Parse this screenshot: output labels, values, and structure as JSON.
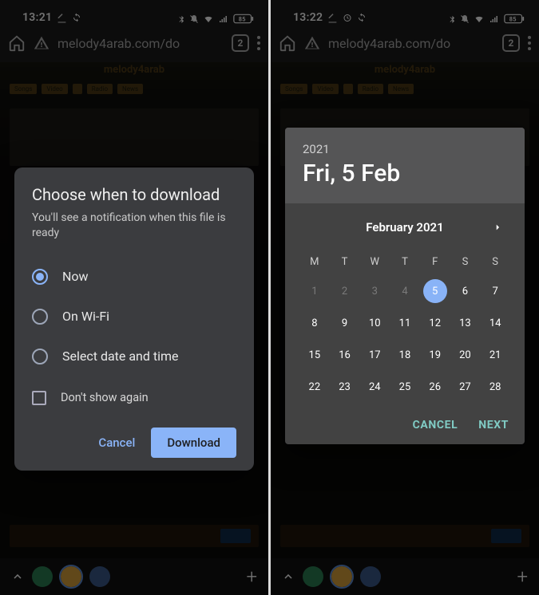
{
  "accent": "#8ab4f8",
  "teal": "#80cbc4",
  "left": {
    "status": {
      "time": "13:21",
      "battery": "85"
    },
    "browser": {
      "url": "melody4arab.com/do",
      "tab_count": "2"
    },
    "dialog": {
      "title": "Choose when to download",
      "subtitle": "You'll see a notification when this file is ready",
      "options": [
        "Now",
        "On Wi-Fi",
        "Select date and time"
      ],
      "selected_index": 0,
      "dont_show_label": "Don't show again",
      "cancel_label": "Cancel",
      "download_label": "Download"
    }
  },
  "right": {
    "status": {
      "time": "13:22",
      "battery": "85"
    },
    "browser": {
      "url": "melody4arab.com/do",
      "tab_count": "2"
    },
    "datepicker": {
      "year": "2021",
      "headline": "Fri, 5 Feb",
      "month_label": "February 2021",
      "dow": [
        "M",
        "T",
        "W",
        "T",
        "F",
        "S",
        "S"
      ],
      "prev_month_days": [
        1,
        2,
        3,
        4
      ],
      "days": [
        5,
        6,
        7,
        8,
        9,
        10,
        11,
        12,
        13,
        14,
        15,
        16,
        17,
        18,
        19,
        20,
        21,
        22,
        23,
        24,
        25,
        26,
        27,
        28
      ],
      "selected_day": 5,
      "cancel_label": "CANCEL",
      "next_label": "NEXT"
    }
  }
}
